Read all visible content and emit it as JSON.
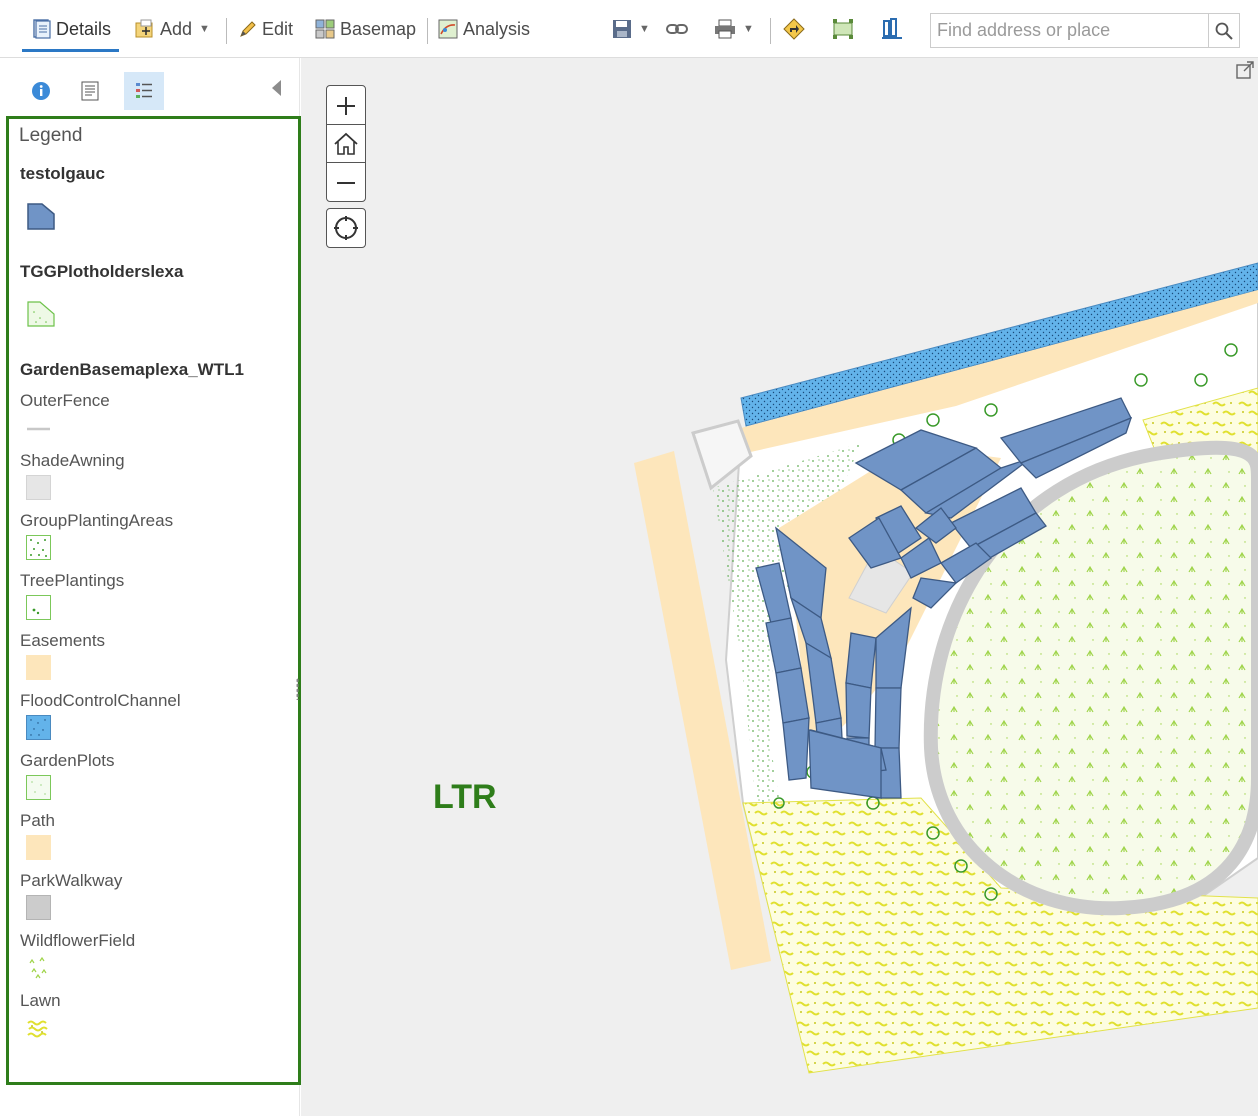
{
  "toolbar": {
    "details_label": "Details",
    "add_label": "Add",
    "edit_label": "Edit",
    "basemap_label": "Basemap",
    "analysis_label": "Analysis"
  },
  "search": {
    "placeholder": "Find address or place"
  },
  "legend": {
    "title": "Legend",
    "layers": [
      {
        "name": "testolgauc"
      },
      {
        "name": "TGGPlotholderslexa"
      },
      {
        "name": "GardenBasemaplexa_WTL1",
        "items": [
          "OuterFence",
          "ShadeAwning",
          "GroupPlantingAreas",
          "TreePlantings",
          "Easements",
          "FloodControlChannel",
          "GardenPlots",
          "Path",
          "ParkWalkway",
          "WildflowerField",
          "Lawn"
        ]
      }
    ]
  },
  "map": {
    "overlay_label": "LTR"
  },
  "colors": {
    "accent_blue": "#2b78c5",
    "legend_border": "#2e7d1a",
    "plot_fill": "#7094c6",
    "easement": "#fde6bb",
    "flood_channel": "#63b3ea",
    "walkway": "#cccccc",
    "lawn_yellow": "#eef05a",
    "wildflower_green": "#a8d84a"
  },
  "icons": [
    "details-icon",
    "add-icon",
    "edit-icon",
    "basemap-icon",
    "analysis-icon",
    "save-icon",
    "share-icon",
    "print-icon",
    "directions-icon",
    "measure-icon",
    "bookmark-icon",
    "search-icon",
    "info-icon",
    "content-icon",
    "legend-icon",
    "zoom-in-icon",
    "home-icon",
    "zoom-out-icon",
    "locate-icon",
    "popout-icon"
  ]
}
